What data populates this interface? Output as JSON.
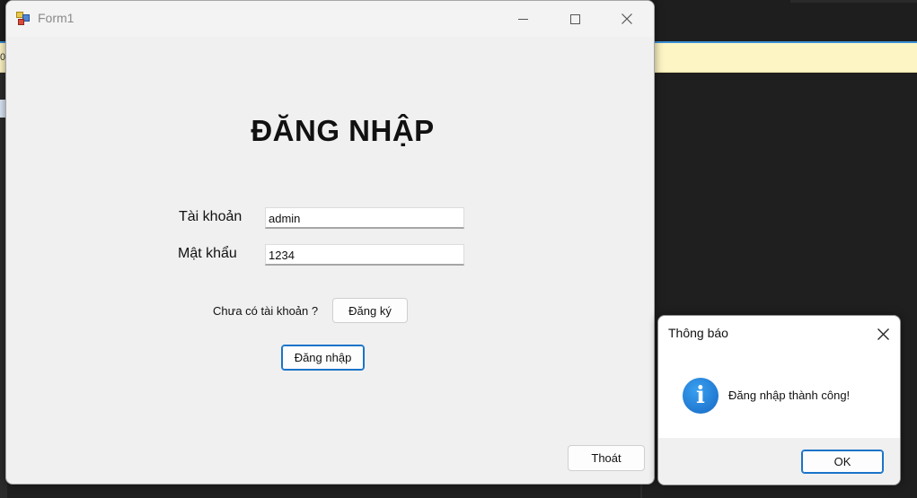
{
  "form": {
    "title": "Form1",
    "heading": "ĐĂNG NHẬP",
    "username_label": "Tài khoản",
    "username_value": "admin",
    "password_label": "Mật khẩu",
    "password_value": "1234",
    "no_account_text": "Chưa có tài khoản ?",
    "register_label": "Đăng ký",
    "login_label": "Đăng nhập",
    "exit_label": "Thoát"
  },
  "message_box": {
    "title": "Thông báo",
    "message": "Đăng nhập thành công!",
    "icon": "info-icon",
    "ok_label": "OK",
    "accent_color": "#1a73c9"
  },
  "background": {
    "infobar_color": "#fdf5c4",
    "editor_color": "#1f1f1f"
  }
}
